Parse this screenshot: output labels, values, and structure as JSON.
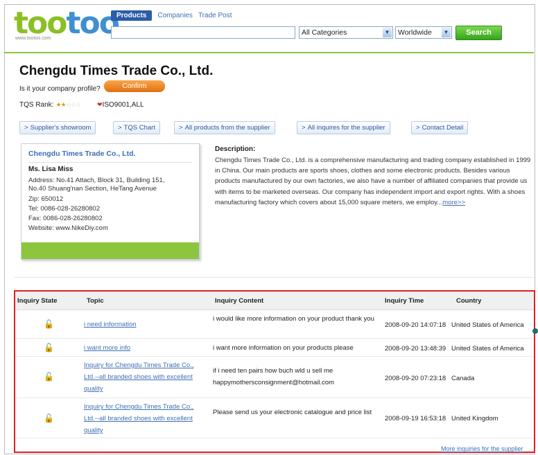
{
  "logo": {
    "part1": "too",
    "part2": "too",
    "sub": "www.tootoo.com"
  },
  "search": {
    "tabs": [
      {
        "label": "Products"
      },
      {
        "label": "Companies"
      },
      {
        "label": "Trade Post"
      }
    ],
    "input_value": "",
    "category": "All Categories",
    "region": "Worldwide",
    "button": "Search"
  },
  "company": {
    "name": "Chengdu Times Trade Co., Ltd.",
    "profile_question": "Is it your company profile?",
    "confirm": "Confirm",
    "tqs_label": "TQS Rank:",
    "stars_on": "★★",
    "stars_off": "☆☆☆",
    "cert": "ISO9001,ALL"
  },
  "nav": [
    {
      "label": "Supplier's showroom"
    },
    {
      "label": "TQS Chart"
    },
    {
      "label": "All products from the supplier"
    },
    {
      "label": "All inquires for the supplier"
    },
    {
      "label": "Contact Detail"
    }
  ],
  "contact": {
    "company": "Chengdu Times Trade Co., Ltd.",
    "person": "Ms. Lisa Miss",
    "address1": "Address: No.41 Attach, Block 31, Building 151,",
    "address2": "No.40 Shuang'nan Section, HeTang Avenue",
    "zip": "Zip: 650012",
    "tel": "Tel: 0086-028-26280802",
    "fax": "Fax: 0086-028-26280802",
    "website": "Website: www.NikeDiy.com"
  },
  "description": {
    "label": "Description:",
    "text": "Chengdu Times Trade Co., Ltd. is a comprehensive manufacturing and trading company established in 1999 in China. Our main products are sports shoes, clothes and some electronic products. Besides various products manufactured by our own factories, we also have a number of affiliated companies that provide us with items to be marketed overseas. Our company has independent import and export rights. With a shoes manufacturing factory which covers about 15,000 square meters, we employ...",
    "more": "more>>"
  },
  "inquiries": {
    "headers": [
      "Inquiry State",
      "Topic",
      "Inquiry Content",
      "Inquiry Time",
      "Country"
    ],
    "rows": [
      {
        "topic": "i need information",
        "content": "i would like more information on your product thank you",
        "time": "2008-09-20 14:07:18",
        "country": "United States of America"
      },
      {
        "topic": "i want more info",
        "content": "i want more information on your products please",
        "time": "2008-09-20 13:48:39",
        "country": "United States of America"
      },
      {
        "topic": "Inquiry for Chengdu Times Trade Co., Ltd.--all branded shoes with excellent quality",
        "content": "if i need ten pairs how buch wld u sell me happymothersconsignment@hotmail.com",
        "time": "2008-09-20 07:23:18",
        "country": "Canada"
      },
      {
        "topic": "Inquiry for Chengdu Times Trade Co., Ltd.--all branded shoes with excellent quality",
        "content": "Please send us your electronic catalogue and price list",
        "time": "2008-09-19 16:53:18",
        "country": "United Kingdom"
      }
    ],
    "more": "More inquiries for the supplier"
  },
  "colors": {
    "brand_green": "#8cc63f",
    "brand_blue": "#3f8fd1",
    "link": "#3f6fb3",
    "highlight": "#e02020"
  }
}
